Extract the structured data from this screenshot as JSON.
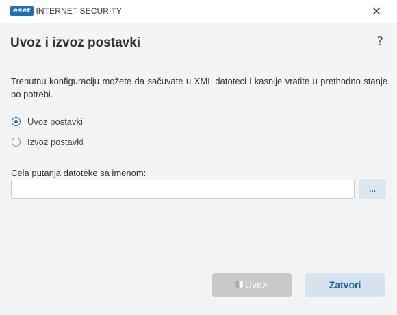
{
  "window": {
    "brand": "eset",
    "product": "INTERNET SECURITY",
    "close_icon": "close-icon"
  },
  "header": {
    "title": "Uvoz i izvoz postavki",
    "help": "?"
  },
  "main": {
    "description": "Trenutnu konfiguraciju možete da sačuvate u XML datoteci i kasnije vratite u prethodno stanje po potrebi.",
    "options": [
      {
        "label": "Uvoz postavki",
        "checked": true
      },
      {
        "label": "Izvoz postavki",
        "checked": false
      }
    ],
    "path_label": "Cela putanja datoteke sa imenom:",
    "path_value": "",
    "browse_label": "..."
  },
  "footer": {
    "import_label": "Uvezi",
    "close_label": "Zatvori"
  },
  "colors": {
    "accent": "#1f6fb5",
    "background": "#f3f4f6",
    "disabled_button": "#c8c9cb",
    "secondary_button": "#d6e3ef"
  }
}
